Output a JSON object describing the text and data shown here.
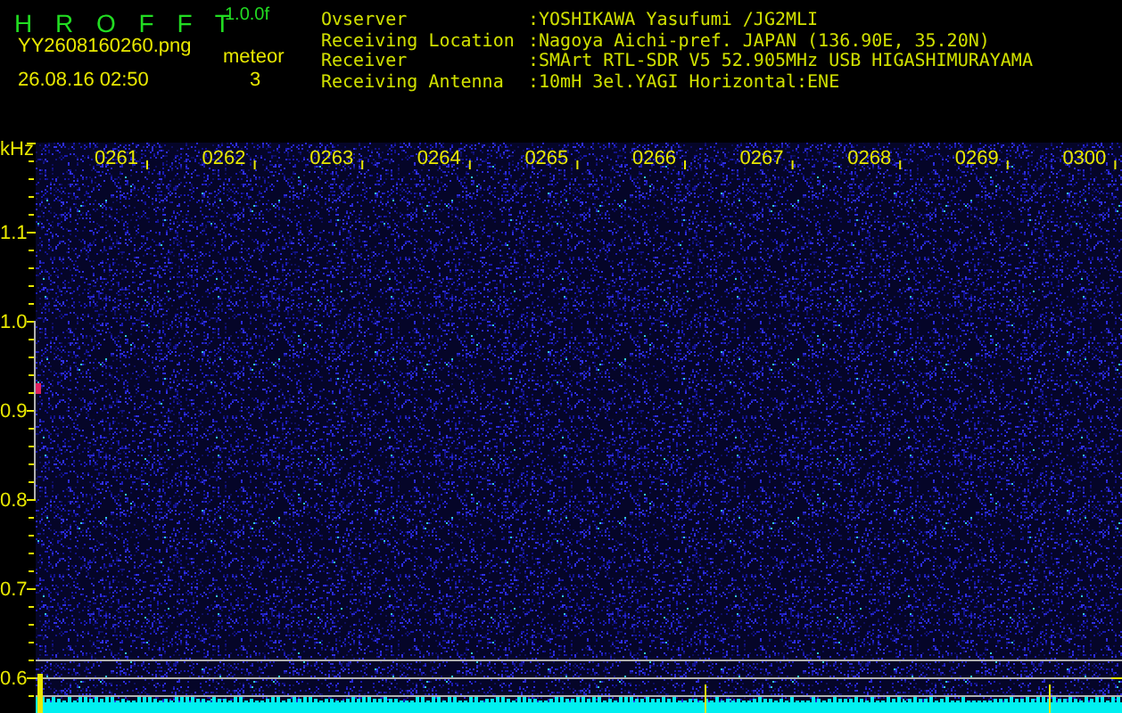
{
  "app": {
    "title": "H R O F F T",
    "version": "1.0.0f",
    "file": "YY2608160260.png",
    "counter_label": "meteor",
    "datetime": "26.08.16 02:50",
    "counter_value": "3"
  },
  "station_info": [
    {
      "label": "Ovserver",
      "value": ":YOSHIKAWA Yasufumi /JG2MLI"
    },
    {
      "label": "Receiving Location",
      "value": ":Nagoya Aichi-pref. JAPAN (136.90E, 35.20N)"
    },
    {
      "label": "Receiver",
      "value": ":SMArt RTL-SDR V5 52.905MHz USB HIGASHIMURAYAMA"
    },
    {
      "label": "Receiving Antenna",
      "value": ":10mH 3el.YAGI Horizontal:ENE"
    }
  ],
  "spectrogram": {
    "y_unit": "kHz",
    "y_ticks": [
      "1.1",
      "1.0",
      "0.9",
      "0.8",
      "0.7",
      "0.6"
    ],
    "time_labels": [
      "0261",
      "0262",
      "0263",
      "0264",
      "0265",
      "0266",
      "0267",
      "0268",
      "0269",
      "0300"
    ]
  }
}
